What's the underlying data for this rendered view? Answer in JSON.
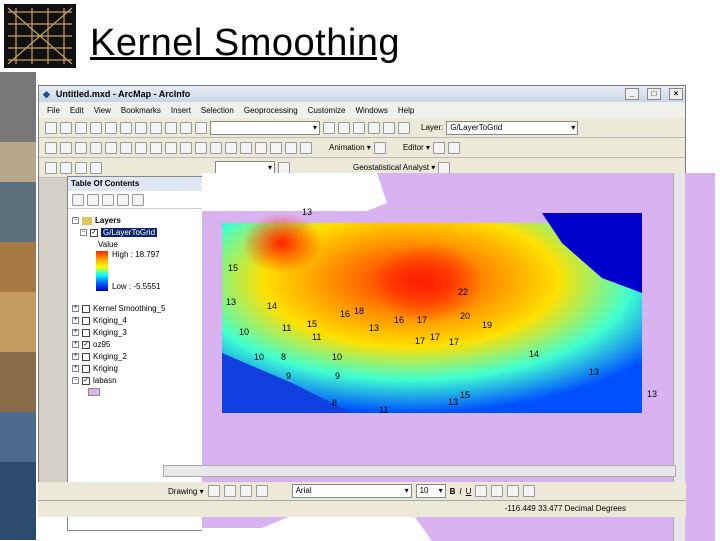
{
  "slide": {
    "title": "Kernel Smoothing"
  },
  "window": {
    "title": "Untitled.mxd - ArcMap - ArcInfo",
    "menu": [
      "File",
      "Edit",
      "View",
      "Bookmarks",
      "Insert",
      "Selection",
      "Geoprocessing",
      "Customize",
      "Windows",
      "Help"
    ],
    "layer_label": "Layer:",
    "layer_value": "G/LayerToGrid",
    "scale_value": "",
    "animation_label": "Animation ▾",
    "editor_label": "Editor ▾",
    "geostat_label": "Geostatistical Analyst ▾",
    "min_btn": "_",
    "max_btn": "□",
    "close_btn": "×"
  },
  "toc": {
    "title": "Table Of Contents",
    "close": "×",
    "layers_label": "Layers",
    "active_layer": "G/LayerToGrid",
    "value_label": "Value",
    "high_label": "High : 18.797",
    "low_label": "Low : -5.5551",
    "layers": [
      {
        "name": "Kernel Smoothing_5",
        "checked": false
      },
      {
        "name": "Kriging_4",
        "checked": false
      },
      {
        "name": "Kriging_3",
        "checked": false
      },
      {
        "name": "oz95",
        "checked": true
      },
      {
        "name": "Kriging_2",
        "checked": false
      },
      {
        "name": "Kriging",
        "checked": false
      },
      {
        "name": "labasn",
        "checked": true
      }
    ]
  },
  "drawing": {
    "label": "Drawing ▾",
    "font": "Arial",
    "size": "10",
    "bold": "B",
    "italic": "I",
    "underline": "U"
  },
  "status": {
    "coords": "-116.449  33.477 Decimal Degrees"
  },
  "map_labels": [
    "13",
    "15",
    "13",
    "14",
    "10",
    "11",
    "15",
    "11",
    "16",
    "18",
    "13",
    "16",
    "17",
    "17",
    "17",
    "17",
    "22",
    "20",
    "19",
    "10",
    "8",
    "10",
    "14",
    "9",
    "9",
    "13",
    "8",
    "11",
    "13",
    "15",
    "13"
  ],
  "colors": {
    "basin": "#d9b3ef",
    "accent": "#0000cc"
  }
}
